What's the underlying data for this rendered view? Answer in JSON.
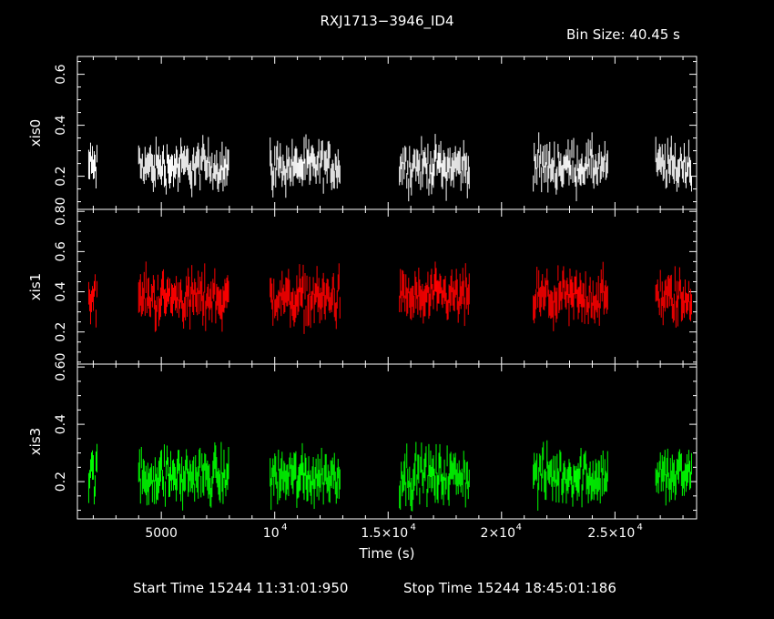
{
  "title": "RXJ1713−3946_ID4",
  "bin_size": "Bin Size: 40.45 s",
  "footer": {
    "start": "Start Time 15244 11:31:01:950",
    "stop": "Stop Time 15244 18:45:01:186"
  },
  "chart_data": {
    "type": "scatter",
    "xlabel": "Time (s)",
    "x_range": [
      1300,
      28600
    ],
    "x_ticks": [
      {
        "value": 5000,
        "label": "5000"
      },
      {
        "value": 10000,
        "mant": "10",
        "exp": "4"
      },
      {
        "value": 15000,
        "mant": "1.5×10",
        "exp": "4"
      },
      {
        "value": 20000,
        "mant": "2×10",
        "exp": "4"
      },
      {
        "value": 25000,
        "mant": "2.5×10",
        "exp": "4"
      }
    ],
    "segments": [
      [
        1800,
        2200
      ],
      [
        4000,
        8000
      ],
      [
        9800,
        12900
      ],
      [
        15500,
        18600
      ],
      [
        21400,
        24700
      ],
      [
        26800,
        28400
      ]
    ],
    "panels": [
      {
        "name": "xis0",
        "color": "#ffffff",
        "ylim": [
          0.07,
          0.67
        ],
        "ticks": [
          0.2,
          0.4,
          0.6
        ],
        "tick_labels": [
          "0.2",
          "0.4",
          "0.6"
        ],
        "mean": 0.24,
        "spread": 0.05
      },
      {
        "name": "xis1",
        "color": "#ff0000",
        "ylim": [
          0.04,
          0.81
        ],
        "ticks": [
          0.2,
          0.4,
          0.6,
          0.8
        ],
        "tick_labels": [
          "0.2",
          "0.4",
          "0.6",
          "0.80"
        ],
        "mean": 0.37,
        "spread": 0.07
      },
      {
        "name": "xis3",
        "color": "#00ff00",
        "ylim": [
          0.07,
          0.61
        ],
        "ticks": [
          0.2,
          0.4,
          0.6
        ],
        "tick_labels": [
          "0.2",
          "0.4",
          "0.60"
        ],
        "mean": 0.22,
        "spread": 0.05
      }
    ]
  }
}
